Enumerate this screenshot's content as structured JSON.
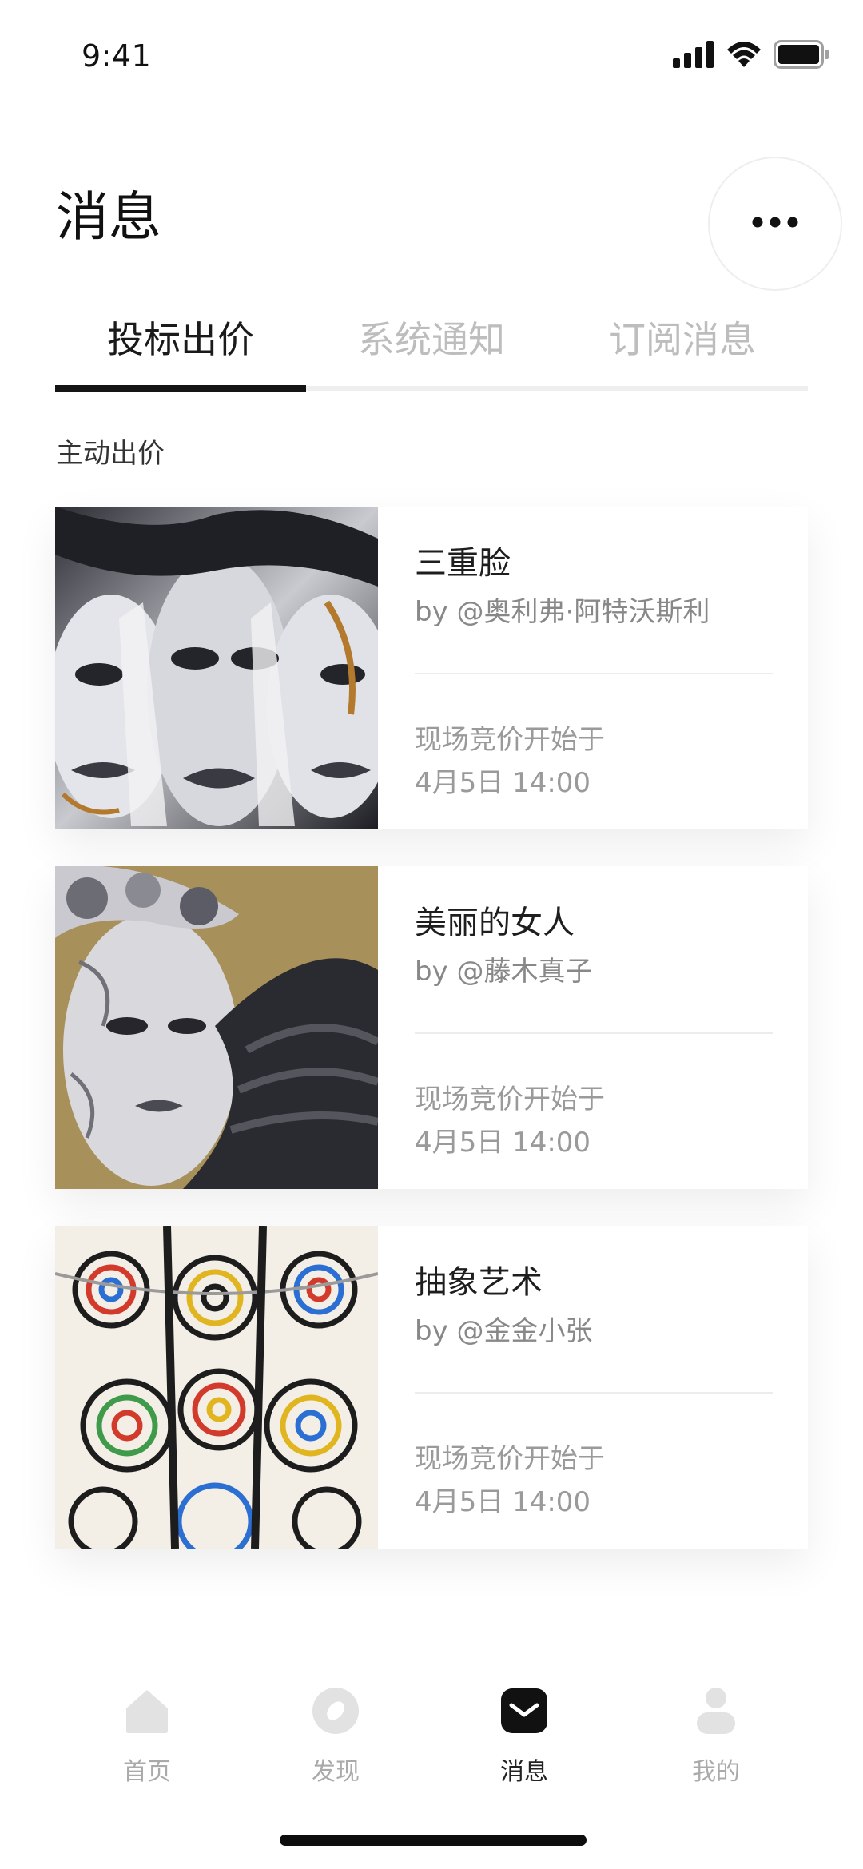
{
  "status_bar": {
    "time": "9:41",
    "icons": [
      "cellular-signal-icon",
      "wifi-icon",
      "battery-icon"
    ]
  },
  "header": {
    "title": "消息",
    "more_icon": "more-horizontal-icon"
  },
  "tabs": [
    {
      "label": "投标出价",
      "active": true
    },
    {
      "label": "系统通知",
      "active": false
    },
    {
      "label": "订阅消息",
      "active": false
    }
  ],
  "section": {
    "label": "主动出价"
  },
  "cards": [
    {
      "title": "三重脸",
      "author": "by @奥利弗·阿特沃斯利",
      "status": "现场竞价开始于",
      "time": "4月5日 14:00",
      "image": "artwork-image-three-faces"
    },
    {
      "title": "美丽的女人",
      "author": "by @藤木真子",
      "status": "现场竞价开始于",
      "time": "4月5日 14:00",
      "image": "artwork-image-beautiful-woman"
    },
    {
      "title": "抽象艺术",
      "author": "by @金金小张",
      "status": "现场竞价开始于",
      "time": "4月5日 14:00",
      "image": "artwork-image-abstract-art"
    }
  ],
  "bottom_nav": [
    {
      "label": "首页",
      "icon": "home-icon",
      "active": false
    },
    {
      "label": "发现",
      "icon": "discover-icon",
      "active": false
    },
    {
      "label": "消息",
      "icon": "message-icon",
      "active": true
    },
    {
      "label": "我的",
      "icon": "profile-icon",
      "active": false
    }
  ],
  "colors": {
    "active_text": "#1a1a1a",
    "inactive_text": "#bdbdbd",
    "indicator": "#151515",
    "muted_text": "#9a9a9a"
  }
}
